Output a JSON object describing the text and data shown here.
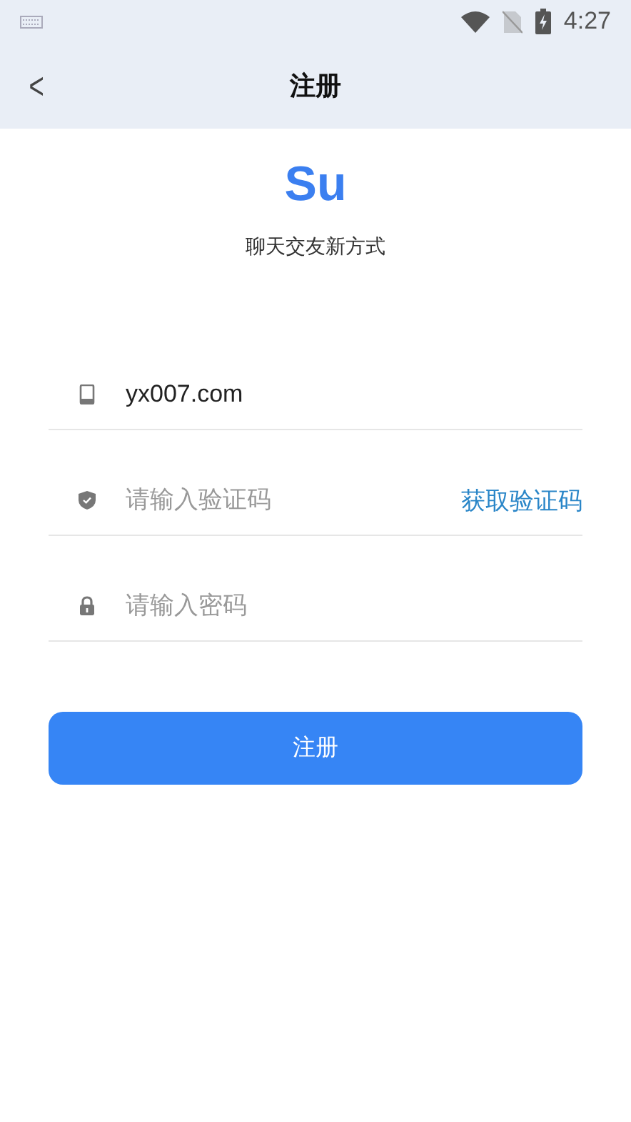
{
  "status_bar": {
    "time": "4:27"
  },
  "header": {
    "back": "<",
    "title": "注册"
  },
  "logo": "Su",
  "tagline": "聊天交友新方式",
  "fields": [
    {
      "kind": "phone",
      "value": "yx007.com"
    },
    {
      "kind": "code",
      "placeholder": "请输入验证码",
      "action": "获取验证码"
    },
    {
      "kind": "password",
      "placeholder": "请输入密码"
    }
  ],
  "submit": "注册"
}
